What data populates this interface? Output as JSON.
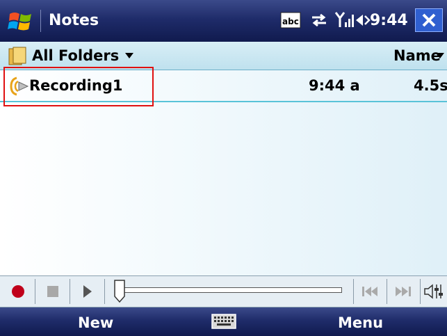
{
  "titlebar": {
    "app_title": "Notes",
    "time": "9:44",
    "icons": [
      "windows-start-icon",
      "input-abc-icon",
      "connectivity-icon",
      "signal-icon",
      "volume-icon",
      "close-icon"
    ]
  },
  "folder_bar": {
    "folder_label": "All Folders",
    "sort_label": "Name"
  },
  "list": {
    "items": [
      {
        "name": "Recording1",
        "time": "9:44 a",
        "length": "4.5s",
        "icon": "voice-recording-icon"
      }
    ]
  },
  "player": {
    "buttons": [
      "record",
      "stop",
      "play",
      "previous",
      "next",
      "volume"
    ],
    "progress": 0
  },
  "softkeys": {
    "left": "New",
    "right": "Menu",
    "center_icon": "keyboard-icon"
  },
  "colors": {
    "title_bar": "#1f2c6a",
    "header_bar": "#c9e8f2",
    "record_button": "#c0001a",
    "highlight_box": "#e01010",
    "row_underline": "#59c3d8"
  }
}
